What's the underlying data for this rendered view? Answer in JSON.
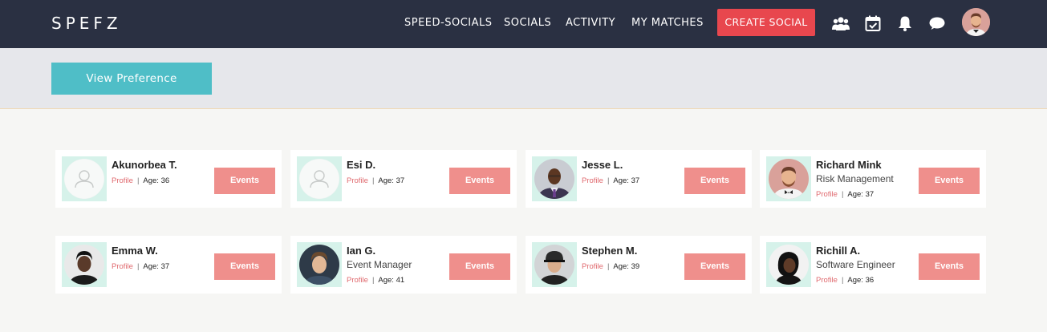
{
  "navbar": {
    "brand": "SPEFZ",
    "links": [
      "SPEED-SOCIALS",
      "SOCIALS",
      "ACTIVITY",
      "MY MATCHES"
    ],
    "create_label": "CREATE SOCIAL",
    "icons": [
      "groups-icon",
      "calendar-icon",
      "bell-icon",
      "chat-icon"
    ]
  },
  "preference": {
    "button_label": "View Preference"
  },
  "colors": {
    "navbar": "#2a3042",
    "accent_red": "#e8474e",
    "teal": "#4fbec7",
    "events": "#ef8f8c"
  },
  "members": [
    {
      "name": "Akunorbea T.",
      "title": "",
      "profile_label": "Profile",
      "age": "Age: 36",
      "events_label": "Events",
      "avatar": "placeholder"
    },
    {
      "name": "Esi D.",
      "title": "",
      "profile_label": "Profile",
      "age": "Age: 37",
      "events_label": "Events",
      "avatar": "placeholder"
    },
    {
      "name": "Jesse L.",
      "title": "",
      "profile_label": "Profile",
      "age": "Age: 37",
      "events_label": "Events",
      "avatar": "photo"
    },
    {
      "name": "Richard Mink",
      "title": "Risk Management",
      "profile_label": "Profile",
      "age": "Age: 37",
      "events_label": "Events",
      "avatar": "photo"
    },
    {
      "name": "Emma W.",
      "title": "",
      "profile_label": "Profile",
      "age": "Age: 37",
      "events_label": "Events",
      "avatar": "photo"
    },
    {
      "name": "Ian G.",
      "title": "Event Manager",
      "profile_label": "Profile",
      "age": "Age: 41",
      "events_label": "Events",
      "avatar": "photo"
    },
    {
      "name": "Stephen M.",
      "title": "",
      "profile_label": "Profile",
      "age": "Age: 39",
      "events_label": "Events",
      "avatar": "photo"
    },
    {
      "name": "Richill A.",
      "title": "Software Engineer",
      "profile_label": "Profile",
      "age": "Age: 36",
      "events_label": "Events",
      "avatar": "photo"
    }
  ]
}
